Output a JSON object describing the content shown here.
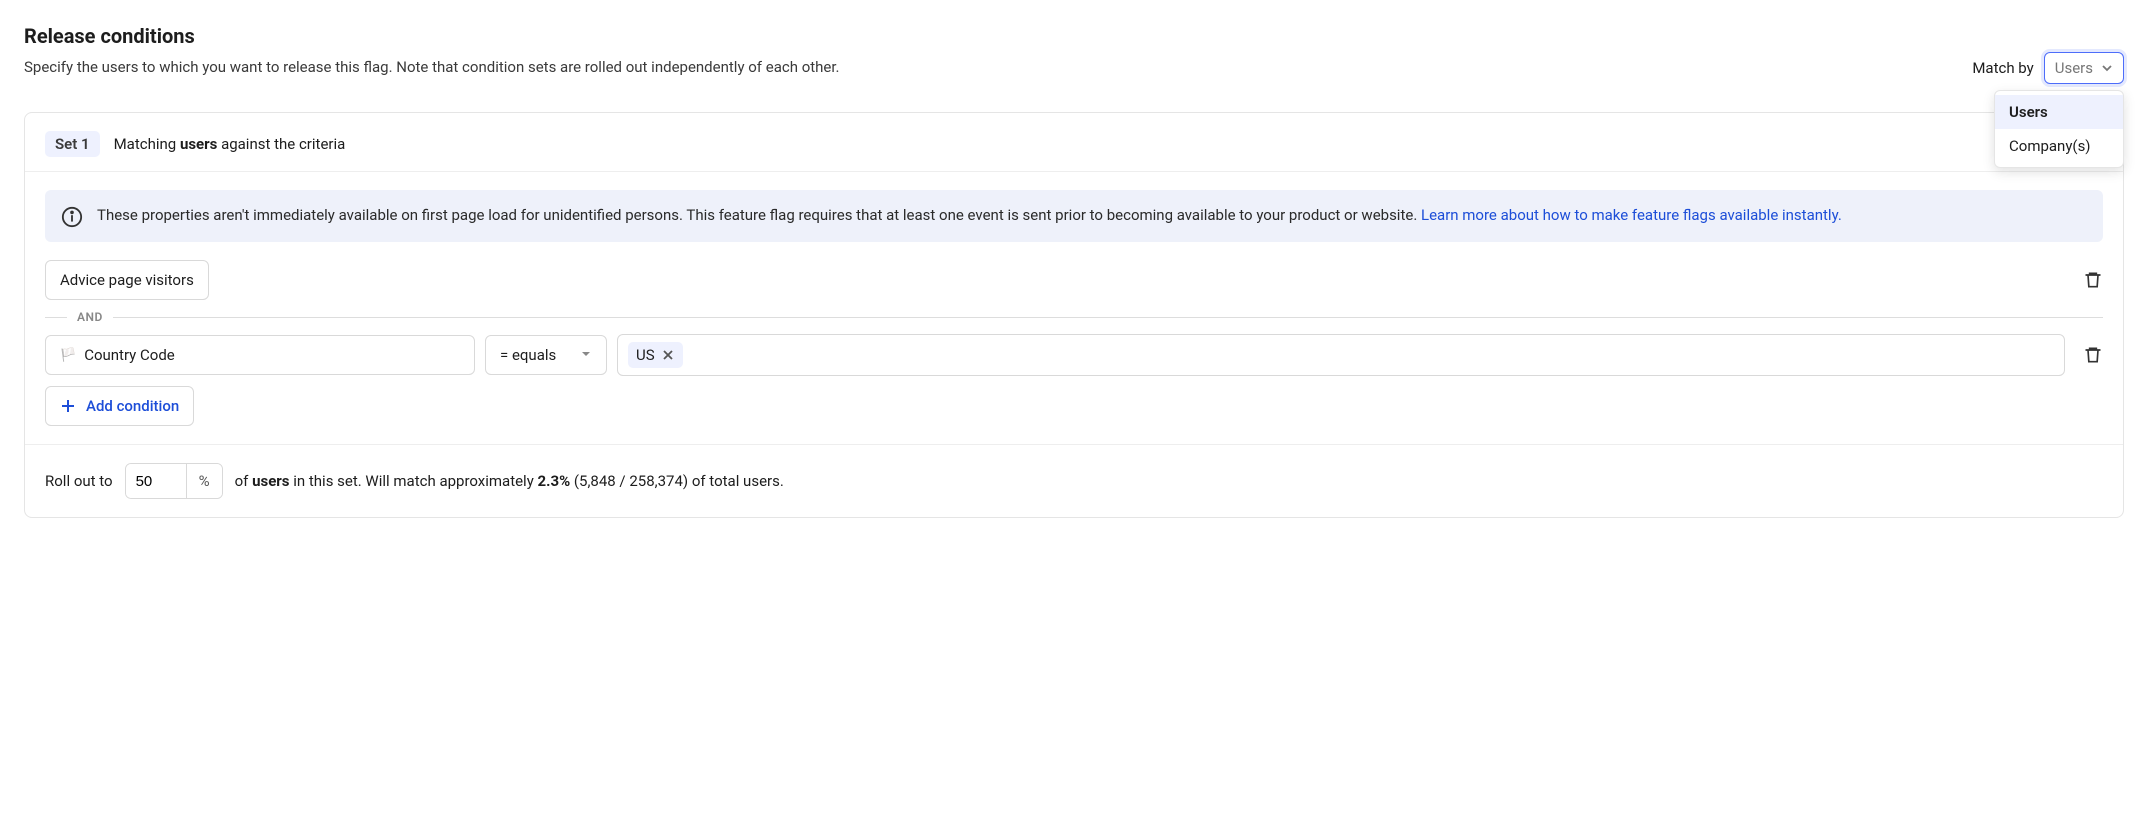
{
  "header": {
    "title": "Release conditions",
    "subtitle": "Specify the users to which you want to release this flag. Note that condition sets are rolled out independently of each other."
  },
  "matchby": {
    "label": "Match by",
    "selected": "Users",
    "options": [
      "Users",
      "Company(s)"
    ]
  },
  "set": {
    "badge": "Set 1",
    "desc_prefix": "Matching ",
    "desc_bold": "users",
    "desc_suffix": " against the criteria"
  },
  "info": {
    "text": "These properties aren't immediately available on first page load for unidentified persons. This feature flag requires that at least one event is sent prior to becoming available to your product or website. ",
    "link_text": "Learn more about how to make feature flags available instantly."
  },
  "conditions": {
    "cohort_chip": "Advice page visitors",
    "and_label": "AND",
    "property_label": "Country Code",
    "operator_label": "= equals",
    "value_chip": "US"
  },
  "addcond": {
    "label": "Add condition"
  },
  "rollout": {
    "prefix": "Roll out to",
    "percent_value": "50",
    "percent_unit": "%",
    "mid1": "of ",
    "mid_bold": "users",
    "mid2": " in this set. Will match approximately ",
    "pct_bold": "2.3%",
    "suffix": " (5,848 / 258,374) of total users."
  }
}
